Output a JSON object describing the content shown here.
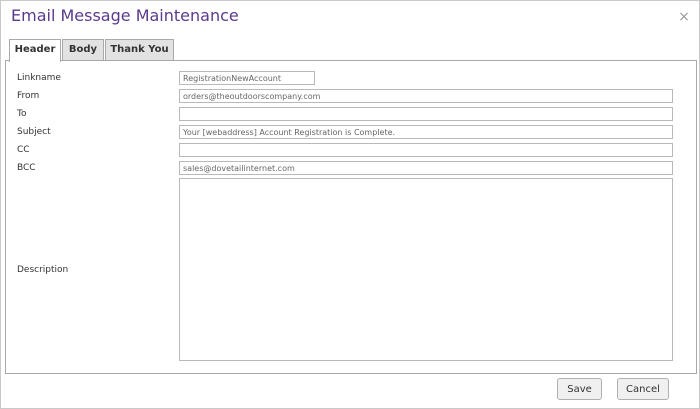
{
  "dialog": {
    "title": "Email Message Maintenance",
    "close_icon": "close-icon",
    "close_glyph": "×"
  },
  "tabs": [
    {
      "label": "Header",
      "active": true
    },
    {
      "label": "Body",
      "active": false
    },
    {
      "label": "Thank You",
      "active": false
    }
  ],
  "form": {
    "linkname": {
      "label": "Linkname",
      "value": "RegistrationNewAccount"
    },
    "from": {
      "label": "From",
      "value": "orders@theoutdoorscompany.com"
    },
    "to": {
      "label": "To",
      "value": ""
    },
    "subject": {
      "label": "Subject",
      "value": "Your [webaddress]  Account Registration is Complete."
    },
    "cc": {
      "label": "CC",
      "value": ""
    },
    "bcc": {
      "label": "BCC",
      "value": "sales@dovetailinternet.com"
    },
    "description": {
      "label": "Description",
      "value": ""
    }
  },
  "buttons": {
    "save_label": "Save",
    "cancel_label": "Cancel"
  },
  "colors": {
    "title": "#5b3a8c",
    "border": "#a9a9a9"
  }
}
